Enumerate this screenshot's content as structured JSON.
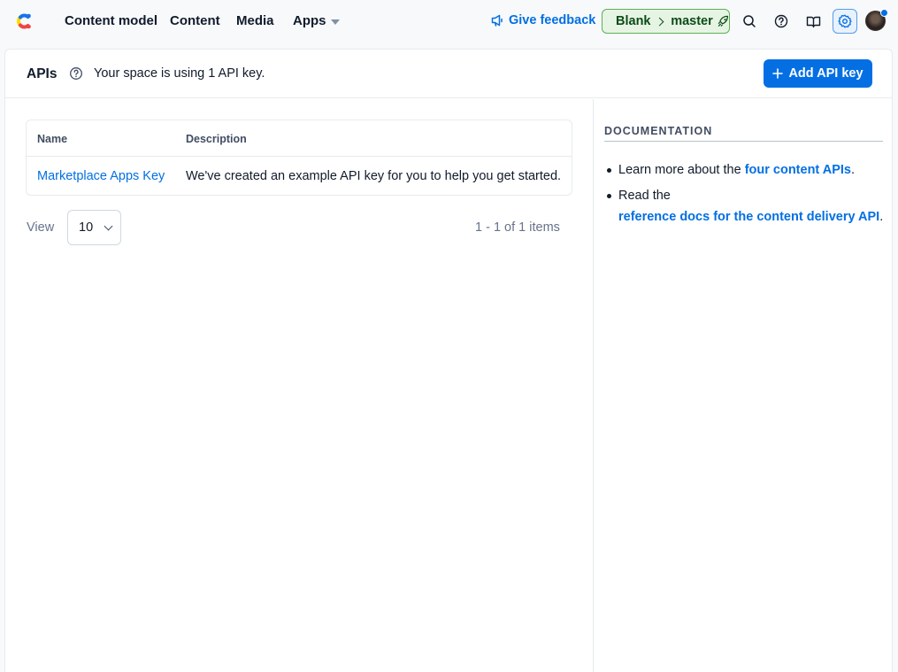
{
  "nav": {
    "items": [
      {
        "label": "Content model"
      },
      {
        "label": "Content"
      },
      {
        "label": "Media"
      },
      {
        "label": "Apps"
      }
    ],
    "feedback_label": "Give feedback",
    "env_space": "Blank",
    "env_name": "master"
  },
  "header": {
    "title": "APIs",
    "usage_text": "Your space is using 1 API key.",
    "add_button_label": "Add API key"
  },
  "table": {
    "columns": [
      "Name",
      "Description"
    ],
    "rows": [
      {
        "name": "Marketplace Apps Key",
        "description": "We've created an example API key for you to help you get started."
      }
    ]
  },
  "pagination": {
    "view_label": "View",
    "page_size": "10",
    "summary": "1 - 1 of 1 items"
  },
  "docs": {
    "title": "DOCUMENTATION",
    "item1_prefix": "Learn more about the",
    "item1_link": "four content APIs",
    "item1_suffix": ".",
    "item2_prefix": "Read the",
    "item2_link": "reference docs for the content delivery API",
    "item2_suffix": "."
  },
  "colors": {
    "accent": "#036fe3",
    "env_bg": "#e6f5e3",
    "env_border": "#5fb057"
  }
}
